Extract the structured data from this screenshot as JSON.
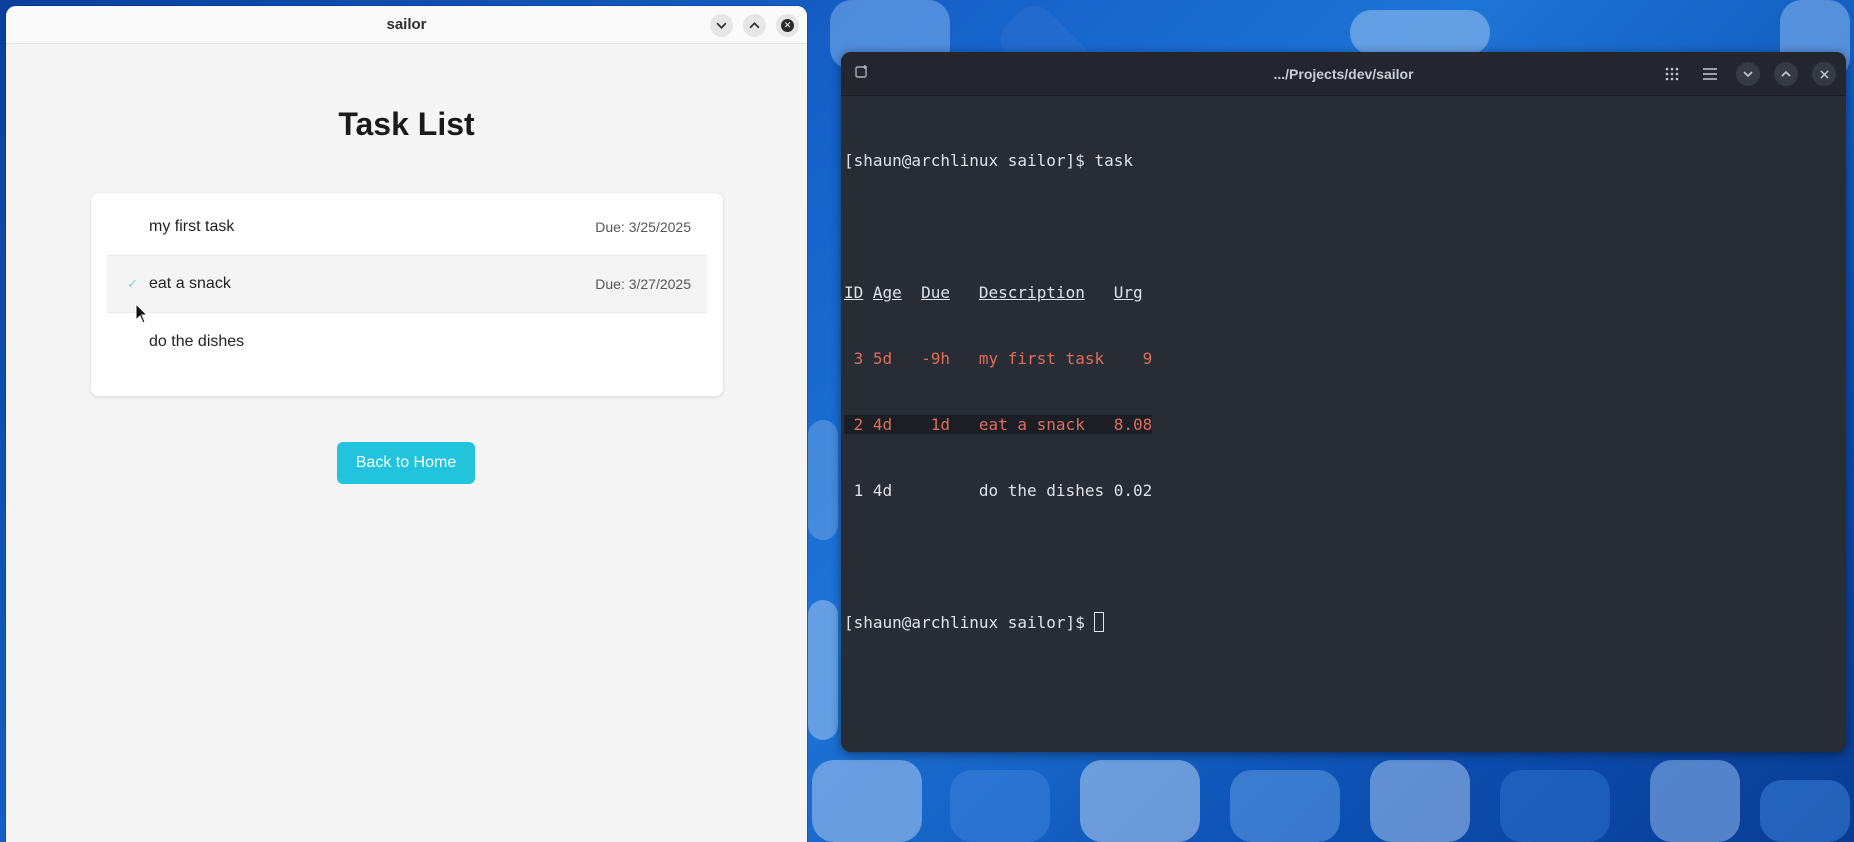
{
  "app": {
    "title": "sailor",
    "page_title": "Task List",
    "tasks": [
      {
        "desc": "my first task",
        "due": "Due: 3/25/2025",
        "check": ""
      },
      {
        "desc": "eat a snack",
        "due": "Due: 3/27/2025",
        "check": "✓"
      },
      {
        "desc": "do the dishes",
        "due": "",
        "check": ""
      }
    ],
    "back_button_label": "Back to Home"
  },
  "terminal": {
    "title": ".../Projects/dev/sailor",
    "lines": {
      "prompt1": "[shaun@archlinux sailor]$ task",
      "blank1": "",
      "header": {
        "id": "ID",
        "age": "Age",
        "due": "Due",
        "desc": "Description",
        "urg": "Urg"
      },
      "row1": " 3 5d   -9h   my first task    9",
      "row2": " 2 4d    1d   eat a snack   8.08",
      "row3": " 1 4d         do the dishes 0.02",
      "blank2": "",
      "prompt2": "[shaun@archlinux sailor]$ "
    }
  },
  "colors": {
    "accent": "#22c3dc",
    "terminal_bg": "#282c34",
    "overdue_red": "#e06c5a"
  }
}
